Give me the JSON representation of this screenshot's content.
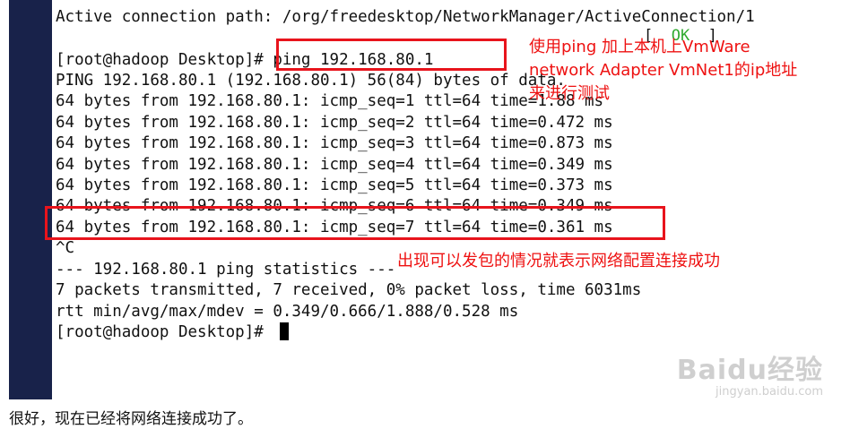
{
  "terminal": {
    "lines": [
      "Active connection path: /org/freedesktop/NetworkManager/ActiveConnection/1",
      "",
      "[root@hadoop Desktop]# ping 192.168.80.1",
      "PING 192.168.80.1 (192.168.80.1) 56(84) bytes of data.",
      "64 bytes from 192.168.80.1: icmp_seq=1 ttl=64 time=1.88 ms",
      "64 bytes from 192.168.80.1: icmp_seq=2 ttl=64 time=0.472 ms",
      "64 bytes from 192.168.80.1: icmp_seq=3 ttl=64 time=0.873 ms",
      "64 bytes from 192.168.80.1: icmp_seq=4 ttl=64 time=0.349 ms",
      "64 bytes from 192.168.80.1: icmp_seq=5 ttl=64 time=0.373 ms",
      "64 bytes from 192.168.80.1: icmp_seq=6 ttl=64 time=0.349 ms",
      "64 bytes from 192.168.80.1: icmp_seq=7 ttl=64 time=0.361 ms",
      "^C",
      "--- 192.168.80.1 ping statistics ---",
      "7 packets transmitted, 7 received, 0% packet loss, time 6031ms",
      "rtt min/avg/max/mdev = 0.349/0.666/1.888/0.528 ms",
      "[root@hadoop Desktop]# "
    ],
    "ok_left": "[  ",
    "ok_text": "OK",
    "ok_right": "  ]"
  },
  "annotations": {
    "note_top": "使用ping 加上本机上VmWare\nnetwork Adapter VmNet1的ip地址\n来进行测试",
    "note_bottom": "出现可以发包的情况就表示网络配置连接成功"
  },
  "watermark": {
    "brand": "Baidu经验",
    "site": "jingyan.baidu.com"
  },
  "caption": "很好，现在已经将网络连接成功了。",
  "colors": {
    "annotation_red": "#e8141c",
    "side_bar": "#18224a",
    "ok_green": "#2faa2f"
  }
}
